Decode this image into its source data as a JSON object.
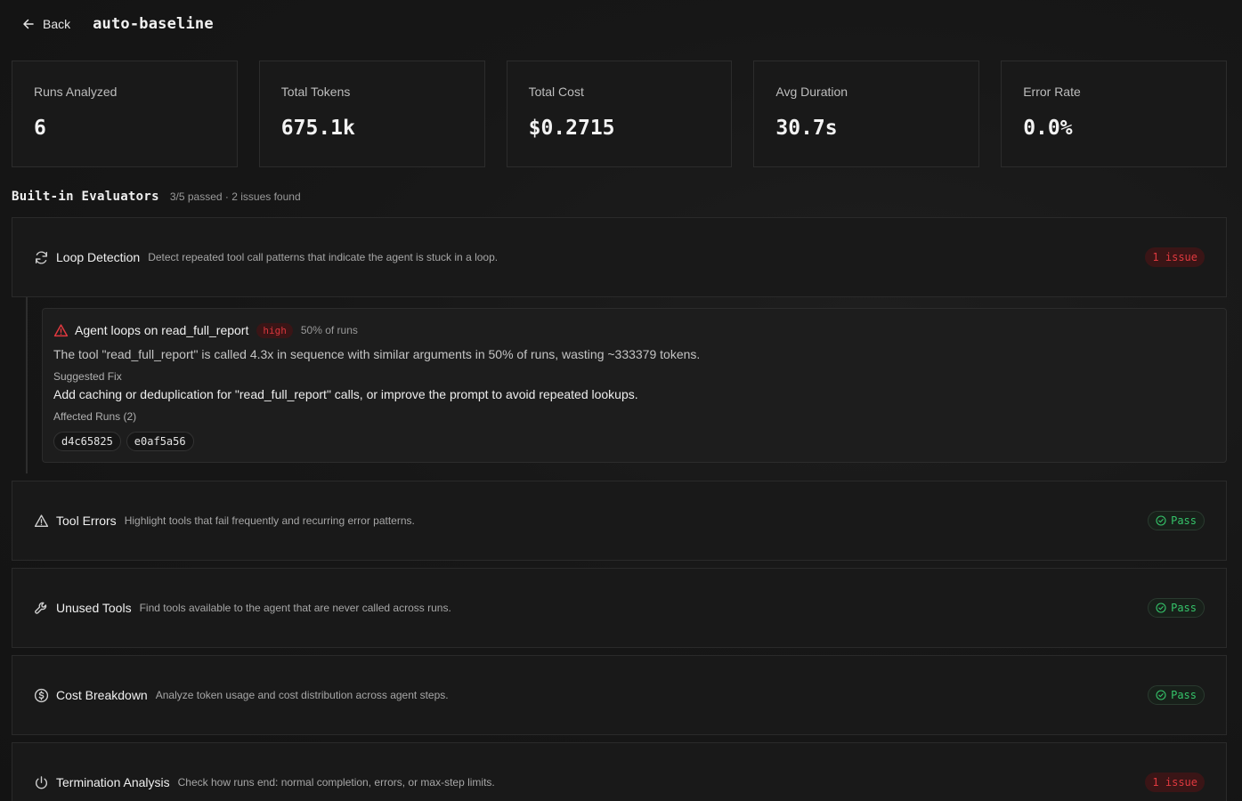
{
  "header": {
    "back_label": "Back",
    "title": "auto-baseline"
  },
  "stats": [
    {
      "label": "Runs Analyzed",
      "value": "6"
    },
    {
      "label": "Total Tokens",
      "value": "675.1k"
    },
    {
      "label": "Total Cost",
      "value": "$0.2715"
    },
    {
      "label": "Avg Duration",
      "value": "30.7s"
    },
    {
      "label": "Error Rate",
      "value": "0.0%"
    }
  ],
  "section": {
    "title": "Built-in Evaluators",
    "summary": "3/5 passed · 2 issues found"
  },
  "evaluators": [
    {
      "name": "Loop Detection",
      "icon": "refresh-icon",
      "description": "Detect repeated tool call patterns that indicate the agent is stuck in a loop.",
      "status": "1 issue"
    },
    {
      "name": "Tool Errors",
      "icon": "warning-icon",
      "description": "Highlight tools that fail frequently and recurring error patterns.",
      "status": "Pass"
    },
    {
      "name": "Unused Tools",
      "icon": "wrench-icon",
      "description": "Find tools available to the agent that are never called across runs.",
      "status": "Pass"
    },
    {
      "name": "Cost Breakdown",
      "icon": "dollar-circle-icon",
      "description": "Analyze token usage and cost distribution across agent steps.",
      "status": "Pass"
    },
    {
      "name": "Termination Analysis",
      "icon": "power-icon",
      "description": "Check how runs end: normal completion, errors, or max-step limits.",
      "status": "1 issue"
    }
  ],
  "finding": {
    "title": "Agent loops on read_full_report",
    "severity": "high",
    "percent": "50% of runs",
    "description": "The tool \"read_full_report\" is called 4.3x in sequence with similar arguments in 50% of runs, wasting ~333379 tokens.",
    "fix_label": "Suggested Fix",
    "fix": "Add caching or deduplication for \"read_full_report\" calls, or improve the prompt to avoid repeated lookups.",
    "runs_label": "Affected Runs (2)",
    "runs": [
      "d4c65825",
      "e0af5a56"
    ]
  },
  "colors": {
    "background": "#151515",
    "issue": "#e0393f",
    "pass": "#35c46a"
  }
}
